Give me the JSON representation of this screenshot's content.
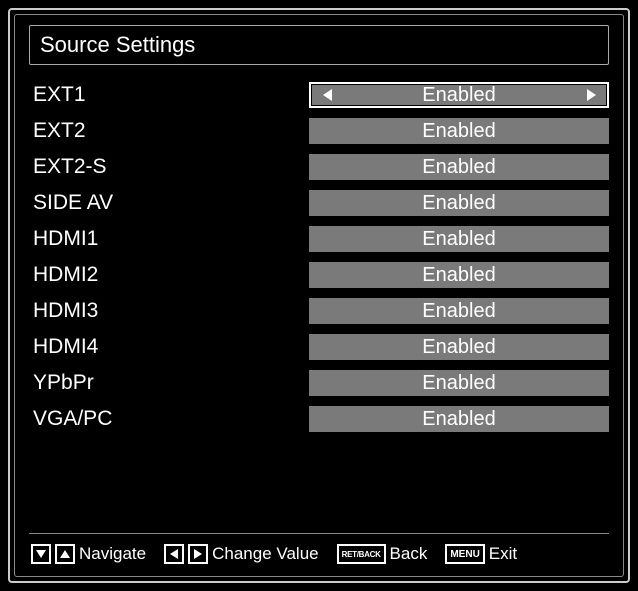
{
  "title": "Source Settings",
  "rows": [
    {
      "label": "EXT1",
      "value": "Enabled",
      "selected": true
    },
    {
      "label": "EXT2",
      "value": "Enabled",
      "selected": false
    },
    {
      "label": "EXT2-S",
      "value": "Enabled",
      "selected": false
    },
    {
      "label": "SIDE AV",
      "value": "Enabled",
      "selected": false
    },
    {
      "label": "HDMI1",
      "value": "Enabled",
      "selected": false
    },
    {
      "label": "HDMI2",
      "value": "Enabled",
      "selected": false
    },
    {
      "label": "HDMI3",
      "value": "Enabled",
      "selected": false
    },
    {
      "label": "HDMI4",
      "value": "Enabled",
      "selected": false
    },
    {
      "label": "YPbPr",
      "value": "Enabled",
      "selected": false
    },
    {
      "label": "VGA/PC",
      "value": "Enabled",
      "selected": false
    }
  ],
  "footer": {
    "navigate": "Navigate",
    "change_value": "Change Value",
    "back_key": "RET/BACK",
    "back": "Back",
    "exit_key": "MENU",
    "exit": "Exit"
  }
}
